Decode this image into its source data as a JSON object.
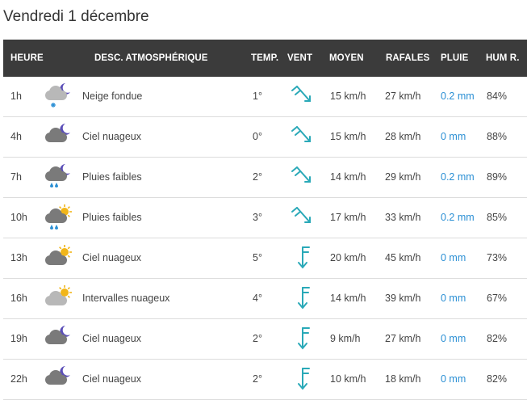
{
  "page": {
    "title": "Vendredi 1 décembre"
  },
  "table": {
    "headers": {
      "hour": "HEURE",
      "desc": "DESC. ATMOSPHÉRIQUE",
      "temp": "TEMP.",
      "wind": "VENT",
      "avg": "MOYEN",
      "gust": "RAFALES",
      "rain": "PLUIE",
      "hum": "HUM R."
    },
    "rows": [
      {
        "hour": "1h",
        "icon": "night-sleet-icon",
        "desc": "Neige fondue",
        "temp": "1°",
        "wind_icon": "wind-arrow-northwest-icon",
        "avg": "15 km/h",
        "gust": "27 km/h",
        "rain": "0.2 mm",
        "hum": "84%"
      },
      {
        "hour": "4h",
        "icon": "night-cloudy-icon",
        "desc": "Ciel nuageux",
        "temp": "0°",
        "wind_icon": "wind-arrow-northwest-icon",
        "avg": "15 km/h",
        "gust": "28 km/h",
        "rain": "0 mm",
        "hum": "88%"
      },
      {
        "hour": "7h",
        "icon": "night-rain-icon",
        "desc": "Pluies faibles",
        "temp": "2°",
        "wind_icon": "wind-arrow-northwest-icon",
        "avg": "14 km/h",
        "gust": "29 km/h",
        "rain": "0.2 mm",
        "hum": "89%"
      },
      {
        "hour": "10h",
        "icon": "day-rain-icon",
        "desc": "Pluies faibles",
        "temp": "3°",
        "wind_icon": "wind-arrow-northwest-icon",
        "avg": "17 km/h",
        "gust": "33 km/h",
        "rain": "0.2 mm",
        "hum": "85%"
      },
      {
        "hour": "13h",
        "icon": "day-cloudy-icon",
        "desc": "Ciel nuageux",
        "temp": "5°",
        "wind_icon": "wind-arrow-north-icon",
        "avg": "20 km/h",
        "gust": "45 km/h",
        "rain": "0 mm",
        "hum": "73%"
      },
      {
        "hour": "16h",
        "icon": "day-partly-cloudy-icon",
        "desc": "Intervalles nuageux",
        "temp": "4°",
        "wind_icon": "wind-arrow-north-icon",
        "avg": "14 km/h",
        "gust": "39 km/h",
        "rain": "0 mm",
        "hum": "67%"
      },
      {
        "hour": "19h",
        "icon": "night-cloudy-icon",
        "desc": "Ciel nuageux",
        "temp": "2°",
        "wind_icon": "wind-arrow-north-icon",
        "avg": "9 km/h",
        "gust": "27 km/h",
        "rain": "0 mm",
        "hum": "82%"
      },
      {
        "hour": "22h",
        "icon": "night-cloudy-icon",
        "desc": "Ciel nuageux",
        "temp": "2°",
        "wind_icon": "wind-arrow-north-icon",
        "avg": "10 km/h",
        "gust": "18 km/h",
        "rain": "0 mm",
        "hum": "82%"
      }
    ]
  },
  "colors": {
    "header_bg": "#3b3b3b",
    "rain_text": "#2a8fd4",
    "wind_arrow": "#2aa9b8",
    "moon": "#5b4fb8",
    "sun": "#f2b619",
    "cloud_dark": "#7a7a7a",
    "cloud_light": "#b8b8b8",
    "rain_drop": "#2a8fd4"
  }
}
